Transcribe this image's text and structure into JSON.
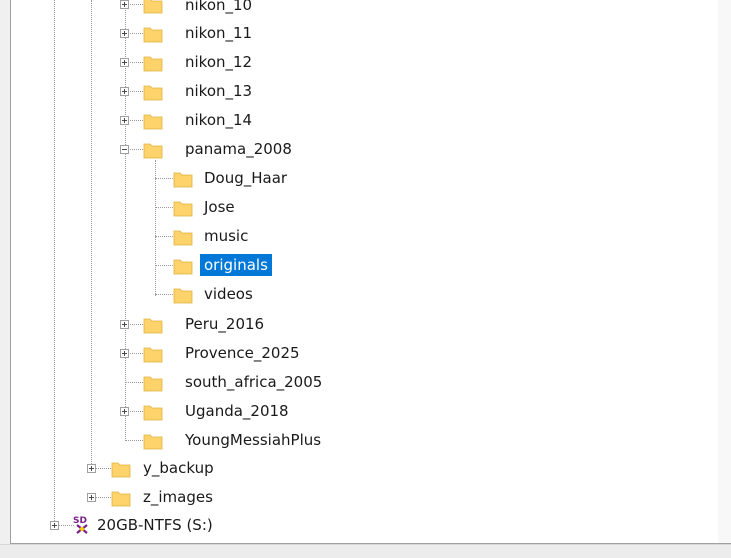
{
  "window": {
    "title": ""
  },
  "colors": {
    "selection": "#0078d7",
    "folder": "#ffd36b"
  },
  "tree": {
    "items": [
      {
        "label": "nikon_10",
        "expander": "plus",
        "icon": "folder-icon"
      },
      {
        "label": "nikon_11",
        "expander": "plus",
        "icon": "folder-icon"
      },
      {
        "label": "nikon_12",
        "expander": "plus",
        "icon": "folder-icon"
      },
      {
        "label": "nikon_13",
        "expander": "plus",
        "icon": "folder-icon"
      },
      {
        "label": "nikon_14",
        "expander": "plus",
        "icon": "folder-icon"
      },
      {
        "label": "panama_2008",
        "expander": "minus",
        "icon": "folder-icon"
      },
      {
        "label": "Doug_Haar",
        "expander": "none",
        "icon": "folder-icon"
      },
      {
        "label": "Jose",
        "expander": "none",
        "icon": "folder-icon"
      },
      {
        "label": "music",
        "expander": "none",
        "icon": "folder-icon"
      },
      {
        "label": "originals",
        "expander": "none",
        "icon": "folder-icon",
        "selected": true
      },
      {
        "label": "videos",
        "expander": "none",
        "icon": "folder-icon"
      },
      {
        "label": "Peru_2016",
        "expander": "plus",
        "icon": "folder-icon"
      },
      {
        "label": "Provence_2025",
        "expander": "plus",
        "icon": "folder-icon"
      },
      {
        "label": "south_africa_2005",
        "expander": "none",
        "icon": "folder-icon"
      },
      {
        "label": "Uganda_2018",
        "expander": "plus",
        "icon": "folder-icon"
      },
      {
        "label": "YoungMessiahPlus",
        "expander": "none",
        "icon": "folder-icon"
      },
      {
        "label": "y_backup",
        "expander": "plus",
        "icon": "folder-icon"
      },
      {
        "label": "z_images",
        "expander": "plus",
        "icon": "folder-icon"
      },
      {
        "label": "20GB-NTFS (S:)",
        "expander": "plus",
        "icon": "drive-icon"
      }
    ]
  }
}
